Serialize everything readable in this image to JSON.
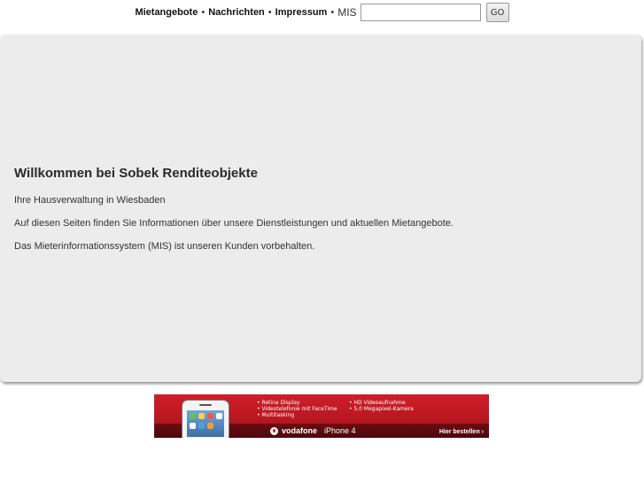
{
  "nav": {
    "items": [
      {
        "label": "Mietangebote"
      },
      {
        "label": "Nachrichten"
      },
      {
        "label": "Impressum"
      }
    ],
    "separator": "•",
    "mis_label": "MIS",
    "search_value": "",
    "go_label": "GO"
  },
  "main": {
    "heading": "Willkommen bei Sobek Renditeobjekte",
    "paragraphs": [
      "Ihre Hausverwaltung in Wiesbaden",
      "Auf diesen Seiten finden Sie Informationen über unsere Dienstleistungen und aktuellen Mietangebote.",
      "Das Mieterinformationssystem (MIS) ist unseren Kunden vorbehalten."
    ]
  },
  "banner": {
    "features_left": [
      "Retina Display",
      "Videotelefonie mit FaceTime",
      "Multitasking"
    ],
    "features_right": [
      "HD Videoaufnahme",
      "5,0 Megapixel-Kamera"
    ],
    "brand": "vodafone",
    "product": "iPhone 4",
    "cta": "Hier bestellen ›",
    "colors": {
      "brand_red": "#d01e28"
    }
  }
}
